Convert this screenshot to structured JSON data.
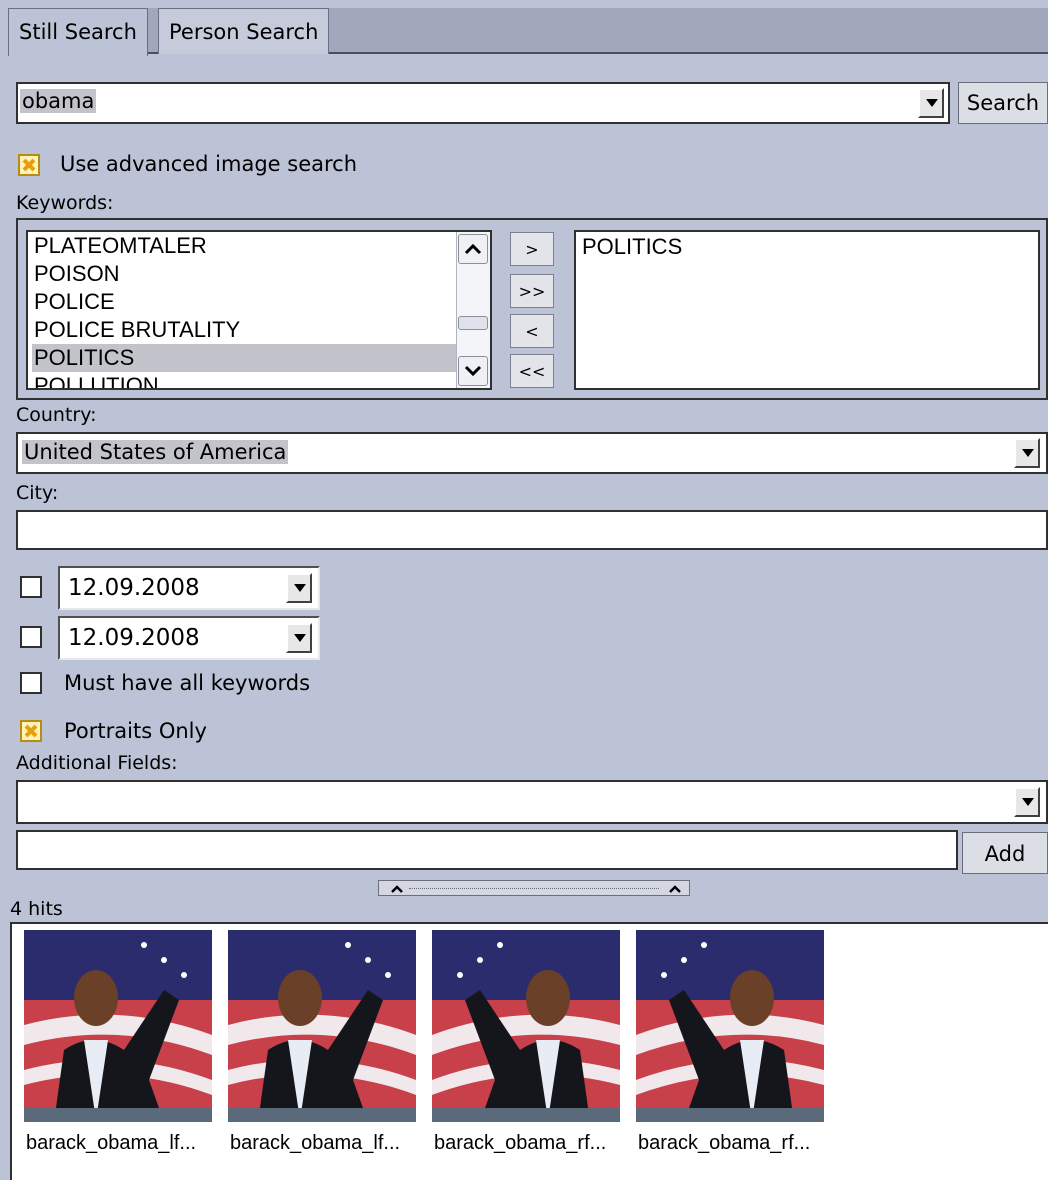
{
  "tabs": {
    "still": "Still Search",
    "person": "Person Search"
  },
  "query": {
    "value": "obama",
    "search_label": "Search"
  },
  "advanced": {
    "label": "Use advanced image search",
    "checked": true
  },
  "keywords": {
    "label": "Keywords:",
    "available": [
      "PLATEOMTALER",
      "POISON",
      "POLICE",
      "POLICE BRUTALITY",
      "POLITICS",
      "POLLUTION"
    ],
    "selected_available": "POLITICS",
    "chosen": [
      "POLITICS"
    ],
    "buttons": {
      "add": ">",
      "add_all": ">>",
      "remove": "<",
      "remove_all": "<<"
    }
  },
  "country": {
    "label": "Country:",
    "value": "United States of America"
  },
  "city": {
    "label": "City:",
    "value": ""
  },
  "dates": {
    "from": "12.09.2008",
    "to": "12.09.2008"
  },
  "must_have_all": {
    "label": "Must have all keywords",
    "checked": false
  },
  "portraits_only": {
    "label": "Portraits Only",
    "checked": true
  },
  "additional_fields": {
    "label": "Additional Fields:",
    "select_value": "",
    "input_value": "",
    "add_label": "Add"
  },
  "results": {
    "count_label": "4 hits",
    "items": [
      {
        "caption": "barack_obama_lf..."
      },
      {
        "caption": "barack_obama_lf..."
      },
      {
        "caption": "barack_obama_rf..."
      },
      {
        "caption": "barack_obama_rf..."
      }
    ]
  },
  "colors": {
    "panel": "#bcc3d6",
    "checkbox_on": "#e79e0c",
    "selection": "#c3c3cc"
  }
}
